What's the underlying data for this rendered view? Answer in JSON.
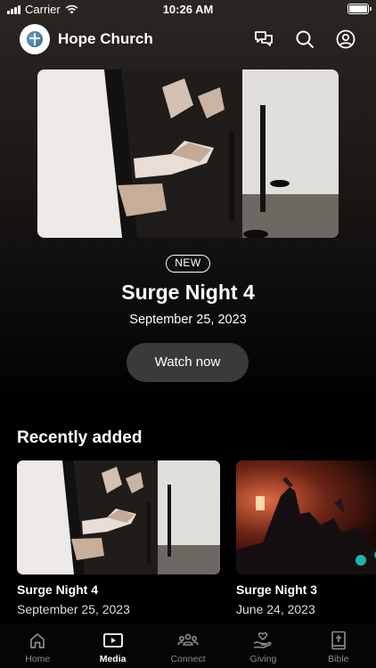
{
  "status_bar": {
    "carrier": "Carrier",
    "time": "10:26 AM"
  },
  "header": {
    "title": "Hope Church"
  },
  "hero": {
    "badge": "NEW",
    "title": "Surge Night 4",
    "date": "September 25, 2023",
    "button": "Watch now"
  },
  "recent": {
    "title": "Recently added",
    "items": [
      {
        "title": "Surge Night 4",
        "date": "September 25, 2023"
      },
      {
        "title": "Surge Night 3",
        "date": "June 24, 2023"
      }
    ]
  },
  "tabs": [
    {
      "label": "Home",
      "icon": "home-icon"
    },
    {
      "label": "Media",
      "icon": "media-icon",
      "active": true
    },
    {
      "label": "Connect",
      "icon": "connect-icon"
    },
    {
      "label": "Giving",
      "icon": "giving-icon"
    },
    {
      "label": "Bible",
      "icon": "bible-icon"
    }
  ]
}
